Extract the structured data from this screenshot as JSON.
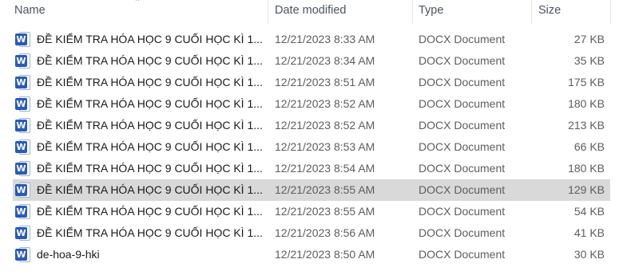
{
  "columns": {
    "name": "Name",
    "date": "Date modified",
    "type": "Type",
    "size": "Size"
  },
  "sort_indicator": "^",
  "icon_letter": "W",
  "files": [
    {
      "name": "ĐỀ KIỂM TRA HÓA HỌC 9 CUỐI HỌC KÌ 1...",
      "date": "12/21/2023 8:33 AM",
      "type": "DOCX Document",
      "size": "27 KB"
    },
    {
      "name": "ĐỀ KIỂM TRA HÓA HỌC 9 CUỐI HỌC KÌ 1...",
      "date": "12/21/2023 8:34 AM",
      "type": "DOCX Document",
      "size": "35 KB"
    },
    {
      "name": "ĐỀ KIỂM TRA HÓA HỌC 9 CUỐI HỌC KÌ 1...",
      "date": "12/21/2023 8:51 AM",
      "type": "DOCX Document",
      "size": "175 KB"
    },
    {
      "name": "ĐỀ KIỂM TRA HÓA HỌC 9 CUỐI HỌC KÌ 1...",
      "date": "12/21/2023 8:52 AM",
      "type": "DOCX Document",
      "size": "180 KB"
    },
    {
      "name": "ĐỀ KIỂM TRA HÓA HỌC 9 CUỐI HỌC KÌ 1...",
      "date": "12/21/2023 8:52 AM",
      "type": "DOCX Document",
      "size": "213 KB"
    },
    {
      "name": "ĐỀ KIỂM TRA HÓA HỌC 9 CUỐI HỌC KÌ 1...",
      "date": "12/21/2023 8:53 AM",
      "type": "DOCX Document",
      "size": "66 KB"
    },
    {
      "name": "ĐỀ KIỂM TRA HÓA HỌC 9 CUỐI HỌC KÌ 1...",
      "date": "12/21/2023 8:54 AM",
      "type": "DOCX Document",
      "size": "180 KB"
    },
    {
      "name": "ĐỀ KIỂM TRA HÓA HỌC 9 CUỐI HỌC KÌ 1...",
      "date": "12/21/2023 8:55 AM",
      "type": "DOCX Document",
      "size": "129 KB",
      "selected": true
    },
    {
      "name": "ĐỀ KIỂM TRA HÓA HỌC 9 CUỐI HỌC KÌ 1...",
      "date": "12/21/2023 8:55 AM",
      "type": "DOCX Document",
      "size": "54 KB"
    },
    {
      "name": "ĐỀ KIỂM TRA HÓA HỌC 9 CUỐI HỌC KÌ 1...",
      "date": "12/21/2023 8:56 AM",
      "type": "DOCX Document",
      "size": "41 KB"
    },
    {
      "name": "de-hoa-9-hki",
      "date": "12/21/2023 8:50 AM",
      "type": "DOCX Document",
      "size": "30 KB"
    }
  ]
}
